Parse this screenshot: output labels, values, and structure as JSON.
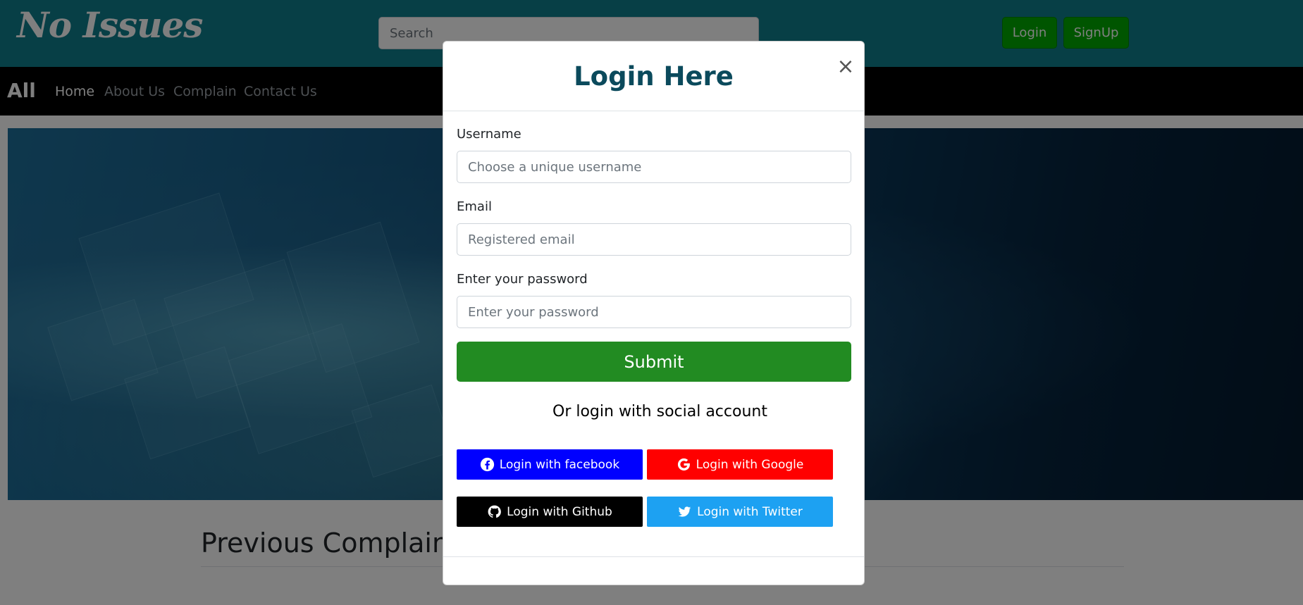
{
  "header": {
    "logo": "No Issues",
    "search_placeholder": "Search",
    "login_label": "Login",
    "signup_label": "SignUp"
  },
  "nav": {
    "brand": "All",
    "links": [
      "Home",
      "About Us",
      "Complain",
      "Contact Us"
    ]
  },
  "page": {
    "section_title": "Previous Complains"
  },
  "modal": {
    "title": "Login Here",
    "close_symbol": "×",
    "fields": [
      {
        "label": "Username",
        "placeholder": "Choose a unique username",
        "value": ""
      },
      {
        "label": "Email",
        "placeholder": "Registered email",
        "value": ""
      },
      {
        "label": "Enter your password",
        "placeholder": "Enter your password",
        "value": ""
      }
    ],
    "submit_label": "Submit",
    "social_heading": "Or login with social account",
    "social_buttons": [
      {
        "label": "Login with facebook",
        "icon": "facebook-icon",
        "color": "#0000ff"
      },
      {
        "label": "Login with Google",
        "icon": "google-icon",
        "color": "#ff0000"
      },
      {
        "label": "Login with Github",
        "icon": "github-icon",
        "color": "#000000"
      },
      {
        "label": "Login with Twitter",
        "icon": "twitter-icon",
        "color": "#1da1f2"
      }
    ]
  },
  "colors": {
    "header_bg": "#0e7f8c",
    "nav_bg": "#000000",
    "submit_bg": "#228b22",
    "modal_title": "#0b4a5c",
    "header_button_bg": "#00aa00"
  }
}
